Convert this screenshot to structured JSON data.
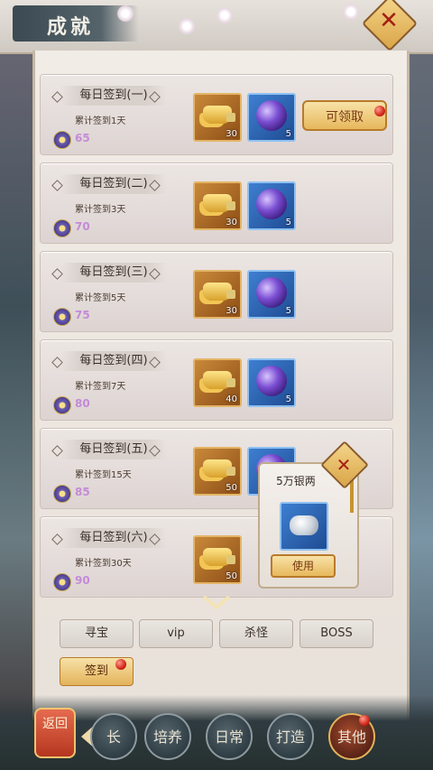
{
  "header": {
    "title": "成就"
  },
  "cards": [
    {
      "title": "每日签到(一)",
      "subtitle": "累计签到1天",
      "points": "65",
      "gold_count": "30",
      "gem_count": "5",
      "claim_label": "可领取"
    },
    {
      "title": "每日签到(二)",
      "subtitle": "累计签到3天",
      "points": "70",
      "gold_count": "30",
      "gem_count": "5"
    },
    {
      "title": "每日签到(三)",
      "subtitle": "累计签到5天",
      "points": "75",
      "gold_count": "30",
      "gem_count": "5"
    },
    {
      "title": "每日签到(四)",
      "subtitle": "累计签到7天",
      "points": "80",
      "gold_count": "40",
      "gem_count": "5"
    },
    {
      "title": "每日签到(五)",
      "subtitle": "累计签到15天",
      "points": "85",
      "gold_count": "50"
    },
    {
      "title": "每日签到(六)",
      "subtitle": "累计签到30天",
      "points": "90",
      "gold_count": "50"
    }
  ],
  "popup": {
    "title": "5万银两",
    "use_label": "使用"
  },
  "tabs": {
    "treasure": "寻宝",
    "vip": "vip",
    "kill": "杀怪",
    "boss": "BOSS",
    "signin": "签到"
  },
  "bottom_nav": {
    "back": "返回",
    "partial": "长",
    "cultivate": "培养",
    "daily": "日常",
    "forge": "打造",
    "other": "其他"
  },
  "colors": {
    "accent_gold": "#e7b85c",
    "points_purple": "#c48ad8",
    "notice_red": "#d3271a"
  }
}
